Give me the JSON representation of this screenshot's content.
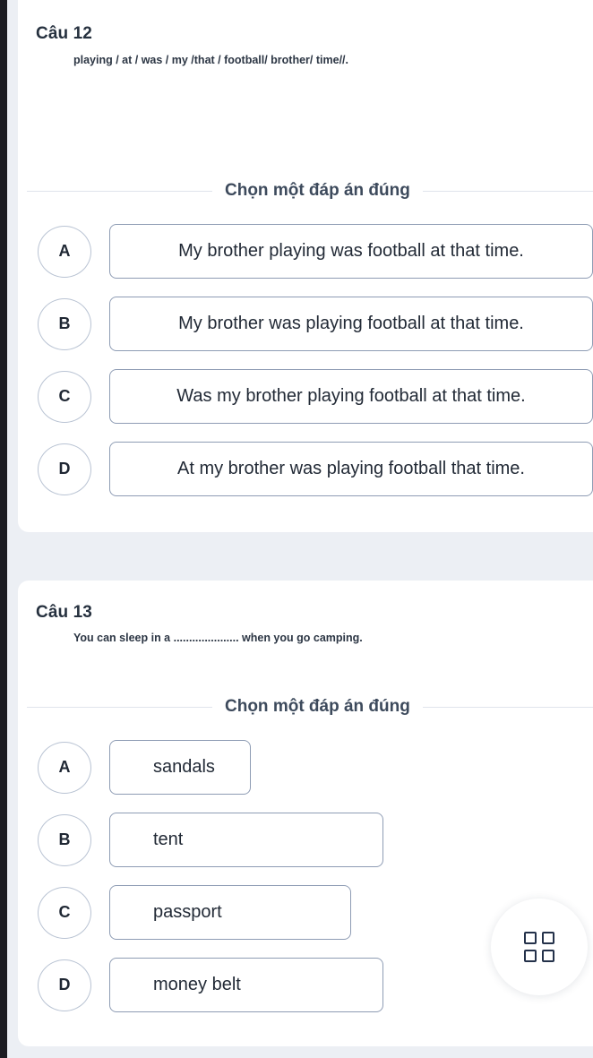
{
  "page": {
    "background_color": "#eceff4",
    "card_color": "#ffffff",
    "accent_text_color": "#26313f",
    "option_border_color": "#8e9cb4",
    "badge_border_color": "#b9c3d3"
  },
  "questions": [
    {
      "heading": "Câu 12",
      "prompt": "playing / at / was / my /that / football/ brother/ time//.",
      "choose_label": "Chọn một đáp án đúng",
      "options": [
        {
          "letter": "A",
          "text": "My brother playing was football at that time."
        },
        {
          "letter": "B",
          "text": "My brother was playing football at that time."
        },
        {
          "letter": "C",
          "text": "Was my brother playing football at that time."
        },
        {
          "letter": "D",
          "text": "At my brother was playing football that time."
        }
      ]
    },
    {
      "heading": "Câu 13",
      "prompt": "You can sleep in a ..................... when you go camping.",
      "choose_label": "Chọn một đáp án đúng",
      "options": [
        {
          "letter": "A",
          "text": "sandals"
        },
        {
          "letter": "B",
          "text": "tent"
        },
        {
          "letter": "C",
          "text": "passport"
        },
        {
          "letter": "D",
          "text": "money belt"
        }
      ]
    }
  ],
  "fab": {
    "icon": "grid-2x2-icon"
  }
}
